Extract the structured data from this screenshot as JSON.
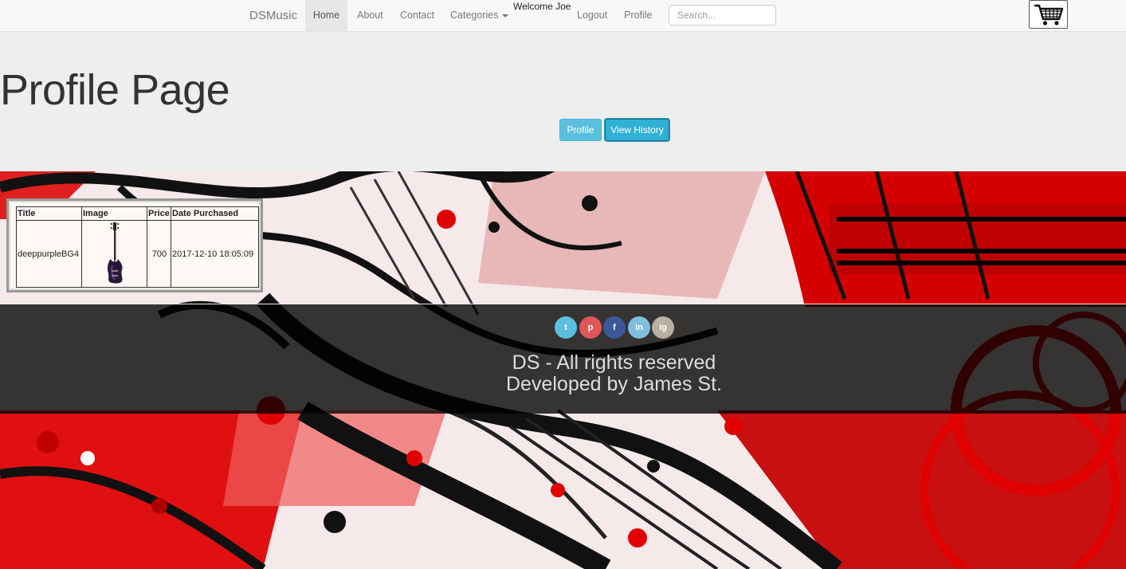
{
  "navbar": {
    "brand": "DSMusic",
    "items": [
      {
        "label": "Home"
      },
      {
        "label": "About"
      },
      {
        "label": "Contact"
      },
      {
        "label": "Categories"
      },
      {
        "label": "Logout"
      },
      {
        "label": "Profile"
      }
    ],
    "welcome": "Welcome Joe",
    "search_placeholder": "Search...",
    "cart_icon": "shopping-cart-icon"
  },
  "jumbotron": {
    "title": "Profile Page",
    "buttons": [
      {
        "label": "Profile"
      },
      {
        "label": "View History"
      }
    ]
  },
  "history": {
    "headers": [
      "Title",
      "Image",
      "Price",
      "Date Purchased"
    ],
    "rows": [
      {
        "title": "deeppurpleBG4",
        "image_icon": "bass-guitar-image",
        "price": "700",
        "date": "2017-12-10 18:05:09"
      }
    ]
  },
  "footer": {
    "social": [
      {
        "name": "twitter-icon",
        "glyph": "t",
        "color": "#5bc0de"
      },
      {
        "name": "pinterest-icon",
        "glyph": "p",
        "color": "#e05757"
      },
      {
        "name": "facebook-icon",
        "glyph": "f",
        "color": "#3b5998"
      },
      {
        "name": "linkedin-icon",
        "glyph": "in",
        "color": "#7fbfdc"
      },
      {
        "name": "instagram-icon",
        "glyph": "ig",
        "color": "#b8b0a0"
      }
    ],
    "line1": "DS - All rights reserved",
    "line2": "Developed by James St."
  },
  "colors": {
    "accent_button": "#5bc0de",
    "art_red": "#e00000"
  }
}
